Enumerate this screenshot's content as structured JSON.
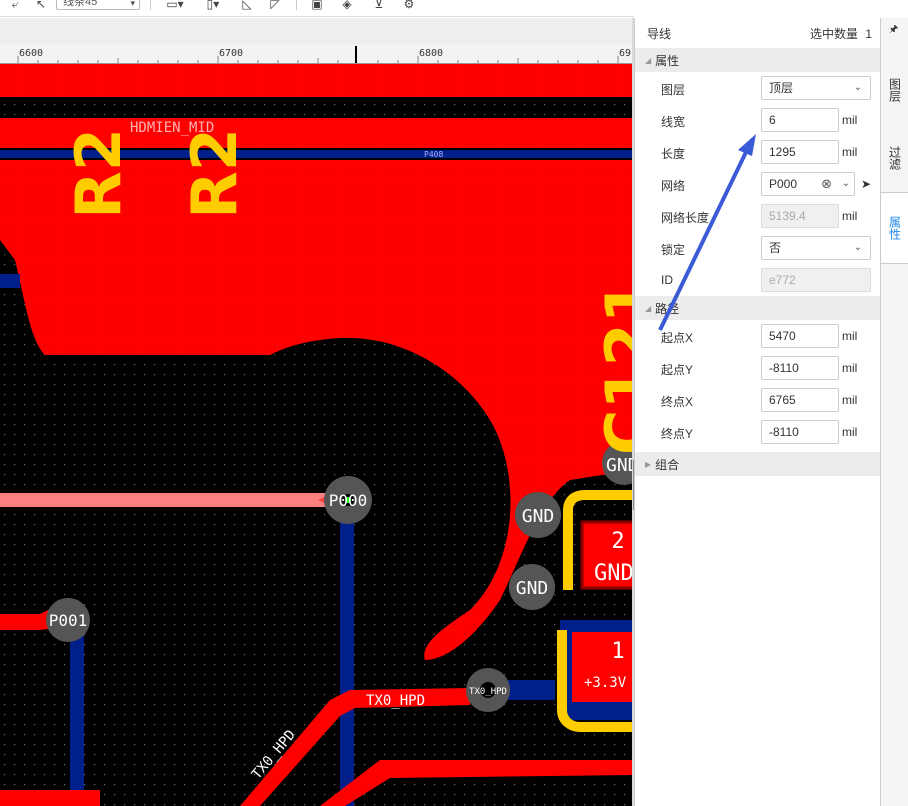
{
  "toolbar": {
    "route_mode": "线条45"
  },
  "ruler": {
    "labels": [
      "6600",
      "6700",
      "6800",
      "69"
    ]
  },
  "canvas": {
    "silk_r2_a": "R2",
    "silk_r2_b": "R2",
    "silk_c121": "C121",
    "net_hdmien": "HDMIEN_MID",
    "net_p408": "P408",
    "pad_p000": "P000",
    "pad_p001": "P001",
    "pad_gnd_1": "GND",
    "pad_gnd_2": "GND",
    "pad_gnd_3": "GND",
    "pad_txo": "TX0_HPD",
    "net_txo_h": "TX0_HPD",
    "net_txo_d": "TX0_HPD",
    "comp_pad2_num": "2",
    "comp_pad2_net": "GND",
    "comp_pad1_num": "1",
    "comp_pad1_net": "+3.3V"
  },
  "panel": {
    "title": "导线",
    "selected_label": "选中数量",
    "selected_count": "1",
    "section_props": "属性",
    "section_path": "路径",
    "section_group": "组合",
    "layer_label": "图层",
    "layer_value": "顶层",
    "width_label": "线宽",
    "width_value": "6",
    "length_label": "长度",
    "length_value": "1295",
    "net_label": "网络",
    "net_value": "P000",
    "netlen_label": "网络长度",
    "netlen_value": "5139.4",
    "lock_label": "锁定",
    "lock_value": "否",
    "id_label": "ID",
    "id_value": "e772",
    "sx_label": "起点X",
    "sx_value": "5470",
    "sy_label": "起点Y",
    "sy_value": "-8110",
    "ex_label": "终点X",
    "ex_value": "6765",
    "ey_label": "终点Y",
    "ey_value": "-8110",
    "unit": "mil"
  },
  "tabs": {
    "layers": "图层",
    "filter": "过滤",
    "props": "属性"
  },
  "colors": {
    "copper_top": "#ff0000",
    "copper_bottom": "#001f8a",
    "silkscreen": "#ffcc00",
    "highlight": "#ff8080",
    "annotation_arrow": "#3b5bd6",
    "active_tab": "#1e88e5"
  }
}
